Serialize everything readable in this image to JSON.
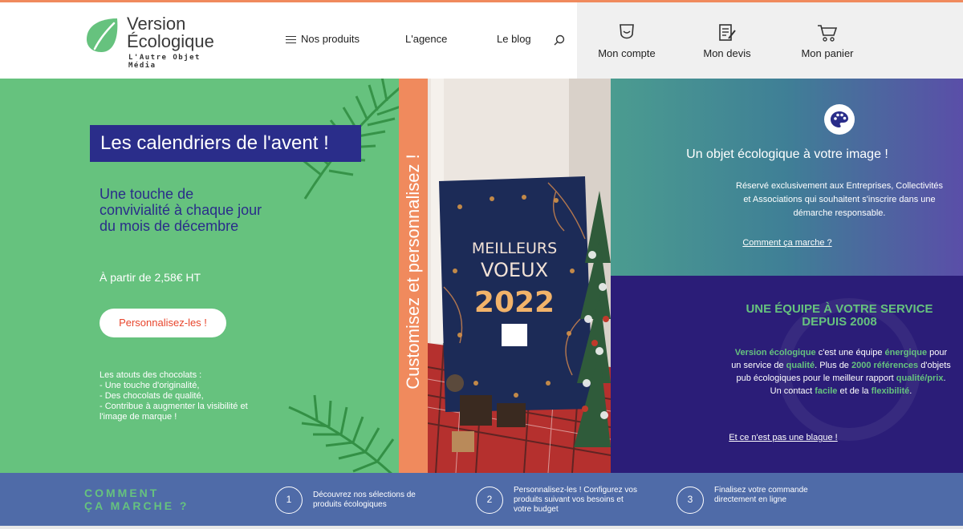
{
  "header": {
    "brand_line1": "Version",
    "brand_line2": "Écologique",
    "tagline": "L'Autre Objet Média",
    "nav": [
      {
        "label": "Nos produits"
      },
      {
        "label": "L'agence"
      },
      {
        "label": "Le blog"
      }
    ],
    "account": [
      {
        "label": "Mon compte",
        "icon": "user-icon"
      },
      {
        "label": "Mon devis",
        "icon": "quote-icon"
      },
      {
        "label": "Mon panier",
        "icon": "cart-icon"
      }
    ]
  },
  "hero": {
    "title": "Les calendriers de l'avent !",
    "subtitle": "Une touche de convivialité à chaque jour du mois de décembre",
    "price": "À partir de 2,58€ HT",
    "cta": "Personnalisez-les !",
    "atouts_title": "Les atouts des chocolats :",
    "atouts": [
      "- Une touche d'originalité,",
      "- Des chocolats de qualité,",
      "- Contribue à augmenter la visibilité et l'image de marque !"
    ]
  },
  "strip": {
    "text": "Customisez et personnalisez !"
  },
  "photo": {
    "line1": "MEILLEURS",
    "line2": "VOEUX",
    "line3": "2022"
  },
  "panel_top": {
    "title": "Un objet écologique à votre image !",
    "desc": "Réservé exclusivement aux Entreprises, Collectivités et Associations qui souhaitent s'inscrire dans une démarche responsable.",
    "link": "Comment ça marche ?"
  },
  "panel_bot": {
    "heading": "UNE ÉQUIPE À VOTRE SERVICE DEPUIS 2008",
    "p1_b": "Version écologique",
    "p1": " c'est une équipe ",
    "p2_b": "énergique",
    "p3": " pour un service de ",
    "p4_b": "qualité",
    "p5": ". Plus de ",
    "p6_b": "2000 références",
    "p7": " d'objets pub écologiques pour le meilleur rapport ",
    "p8_b": "qualité/prix",
    "p9": ". Un contact ",
    "p10_b": "facile",
    "p11": " et de la ",
    "p12_b": "flexibilité",
    "p13": ".",
    "link": "Et ce n'est pas une blague !"
  },
  "steps": {
    "label_line1": "COMMENT",
    "label_line2": "ÇA MARCHE ?",
    "items": [
      {
        "num": "1",
        "text": "Découvrez nos sélections de produits écologiques"
      },
      {
        "num": "2",
        "text": "Personnalisez-les ! Configurez vos produits suivant vos besoins et votre budget"
      },
      {
        "num": "3",
        "text": "Finalisez votre commande directement en ligne"
      }
    ]
  },
  "colors": {
    "green": "#66c27e",
    "navy": "#2a2d8a",
    "orange": "#f08a5d",
    "purple": "#2b1d78",
    "steps_blue": "#4f6ba8"
  }
}
